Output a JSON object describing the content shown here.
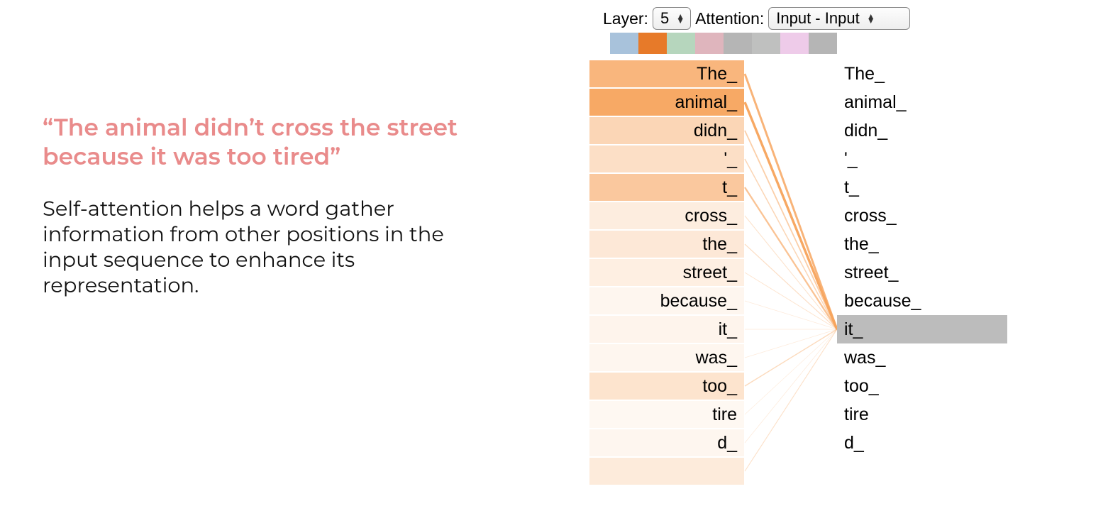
{
  "left": {
    "quote": "“The animal didn’t cross the street because it was too tired”",
    "explain": "Self-attention helps a word gather information from other positions in the input sequence to enhance its representation."
  },
  "controls": {
    "layer_label": "Layer:",
    "layer_value": "5",
    "attention_label": "Attention:",
    "attention_value": "Input - Input"
  },
  "swatch_colors": [
    "#a8c2db",
    "#e77a29",
    "#b6d6bd",
    "#dfb5bd",
    "#b5b5b5",
    "#bfc0bf",
    "#eecbe9",
    "#b5b5b5"
  ],
  "tokens_left": [
    {
      "t": "The_",
      "w": 0.8
    },
    {
      "t": "animal_",
      "w": 0.95
    },
    {
      "t": "didn_",
      "w": 0.45
    },
    {
      "t": "'_",
      "w": 0.35
    },
    {
      "t": "t_",
      "w": 0.6
    },
    {
      "t": "cross_",
      "w": 0.2
    },
    {
      "t": "the_",
      "w": 0.25
    },
    {
      "t": "street_",
      "w": 0.18
    },
    {
      "t": "because_",
      "w": 0.1
    },
    {
      "t": "it_",
      "w": 0.12
    },
    {
      "t": "was_",
      "w": 0.1
    },
    {
      "t": "too_",
      "w": 0.3
    },
    {
      "t": "tire",
      "w": 0.08
    },
    {
      "t": "d_",
      "w": 0.1
    },
    {
      "t": "",
      "w": 0.22
    }
  ],
  "tokens_right": [
    "The_",
    "animal_",
    "didn_",
    "'_",
    "t_",
    "cross_",
    "the_",
    "street_",
    "because_",
    "it_",
    "was_",
    "too_",
    "tire",
    "d_"
  ],
  "focus_right_index": 9,
  "attn_color": "#f7a45d"
}
